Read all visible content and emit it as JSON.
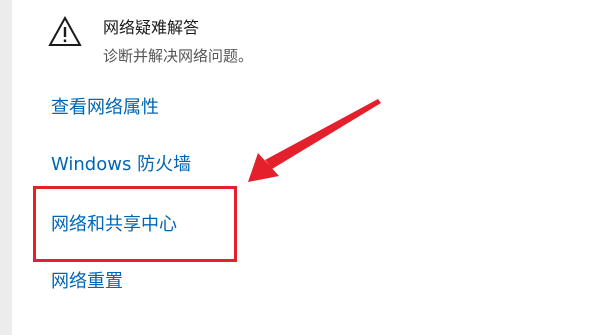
{
  "troubleshoot": {
    "icon": "warning-icon",
    "title": "网络疑难解答",
    "description": "诊断并解决网络问题。"
  },
  "links": {
    "view_properties": "查看网络属性",
    "firewall": "Windows 防火墙",
    "sharing_center": "网络和共享中心",
    "network_reset": "网络重置"
  },
  "annotation": {
    "color": "#e3202c",
    "arrow_icon": "red-arrow"
  },
  "colors": {
    "link": "#0066b4"
  }
}
